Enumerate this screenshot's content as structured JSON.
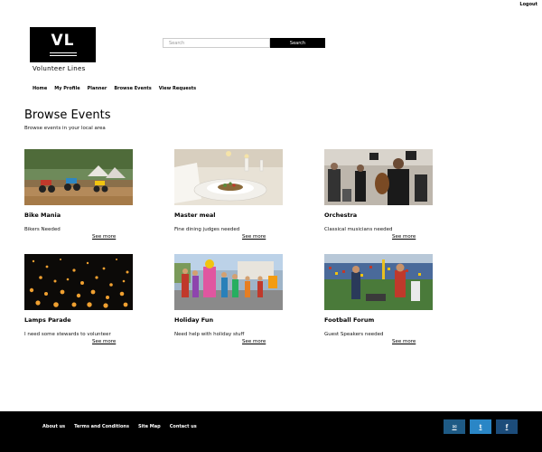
{
  "header": {
    "logout_label": "Logout",
    "logo_letters": "VL",
    "site_name": "Volunteer Lines"
  },
  "search": {
    "placeholder": "Search",
    "value": "",
    "button_label": "Search"
  },
  "nav": {
    "items": [
      {
        "label": "Home"
      },
      {
        "label": "My Profile"
      },
      {
        "label": "Planner"
      },
      {
        "label": "Browse Events"
      },
      {
        "label": "View Requests"
      }
    ]
  },
  "main": {
    "title": "Browse Events",
    "subtitle": "Browse events in your local area",
    "events": [
      {
        "title": "Bike Mania",
        "description": "Bikers Needed",
        "more_label": "See more",
        "image_icon": "motocross-photo"
      },
      {
        "title": "Master meal",
        "description": "Fine dining judges needed",
        "more_label": "See more",
        "image_icon": "dinner-plate-photo"
      },
      {
        "title": "Orchestra",
        "description": "Classical musicians needed",
        "more_label": "See more",
        "image_icon": "orchestra-photo"
      },
      {
        "title": "Lamps Parade",
        "description": "I need some stewards to volunteer",
        "more_label": "See more",
        "image_icon": "lanterns-photo"
      },
      {
        "title": "Holiday Fun",
        "description": "Need help with holiday stuff",
        "more_label": "See more",
        "image_icon": "parade-photo"
      },
      {
        "title": "Football Forum",
        "description": "Guest Speakers needed",
        "more_label": "See more",
        "image_icon": "football-photo"
      }
    ]
  },
  "footer": {
    "links": [
      {
        "label": "About us"
      },
      {
        "label": "Terms and Conditions"
      },
      {
        "label": "Site Map"
      },
      {
        "label": "Contact us"
      }
    ],
    "social": [
      {
        "icon": "email-icon",
        "glyph": "✉",
        "color": "#1e5a85"
      },
      {
        "icon": "twitter-icon",
        "glyph": "t",
        "color": "#2a86c6"
      },
      {
        "icon": "facebook-icon",
        "glyph": "f",
        "color": "#1c4c7a"
      }
    ]
  },
  "colors": {
    "primary": "#000000",
    "background": "#ffffff"
  }
}
